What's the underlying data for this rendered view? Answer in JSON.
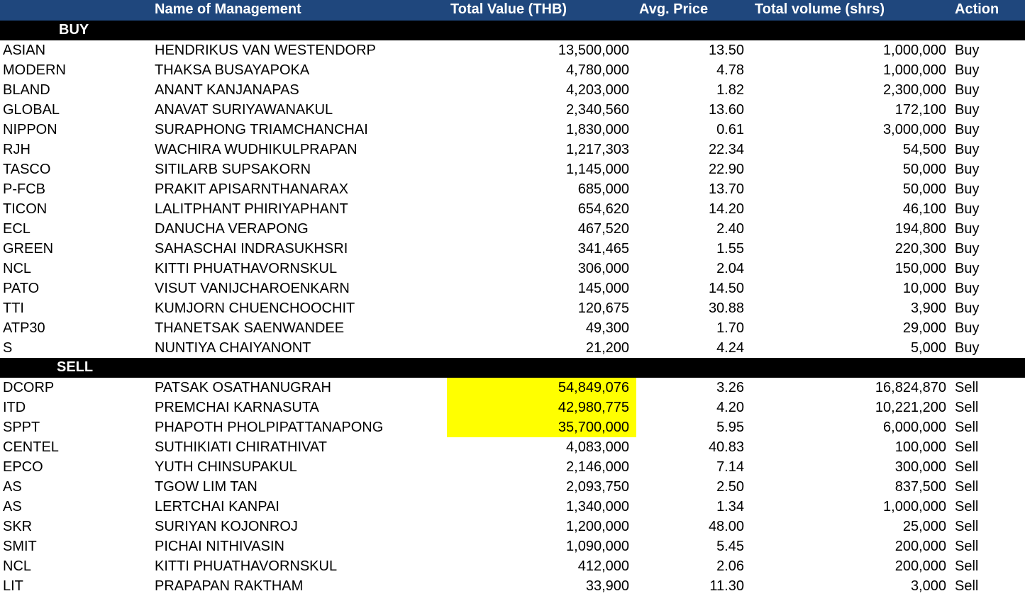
{
  "header": {
    "name": "Name of Management",
    "value": "Total Value (THB)",
    "price": "Avg. Price",
    "volume": "Total volume (shrs)",
    "action": "Action"
  },
  "colors": {
    "header_bg": "#1f477d",
    "band_bg": "#000000",
    "highlight": "#ffff00"
  },
  "buy": {
    "label": "BUY",
    "rows": [
      {
        "sym": "ASIAN",
        "name": "HENDRIKUS VAN  WESTENDORP",
        "value": "13,500,000",
        "price": "13.50",
        "volume": "1,000,000",
        "action": "Buy"
      },
      {
        "sym": "MODERN",
        "name": "THAKSA  BUSAYAPOKA",
        "value": "4,780,000",
        "price": "4.78",
        "volume": "1,000,000",
        "action": "Buy"
      },
      {
        "sym": "BLAND",
        "name": "ANANT  KANJANAPAS",
        "value": "4,203,000",
        "price": "1.82",
        "volume": "2,300,000",
        "action": "Buy"
      },
      {
        "sym": "GLOBAL",
        "name": "ANAVAT  SURIYAWANAKUL",
        "value": "2,340,560",
        "price": "13.60",
        "volume": "172,100",
        "action": "Buy"
      },
      {
        "sym": "NIPPON",
        "name": "SURAPHONG  TRIAMCHANCHAI",
        "value": "1,830,000",
        "price": "0.61",
        "volume": "3,000,000",
        "action": "Buy"
      },
      {
        "sym": "RJH",
        "name": "WACHIRA  WUDHIKULPRAPAN",
        "value": "1,217,303",
        "price": "22.34",
        "volume": "54,500",
        "action": "Buy"
      },
      {
        "sym": "TASCO",
        "name": "SITILARB  SUPSAKORN",
        "value": "1,145,000",
        "price": "22.90",
        "volume": "50,000",
        "action": "Buy"
      },
      {
        "sym": "P-FCB",
        "name": "PRAKIT  APISARNTHANARAX",
        "value": "685,000",
        "price": "13.70",
        "volume": "50,000",
        "action": "Buy"
      },
      {
        "sym": "TICON",
        "name": "LALITPHANT  PHIRIYAPHANT",
        "value": "654,620",
        "price": "14.20",
        "volume": "46,100",
        "action": "Buy"
      },
      {
        "sym": "ECL",
        "name": "DANUCHA  VERAPONG",
        "value": "467,520",
        "price": "2.40",
        "volume": "194,800",
        "action": "Buy"
      },
      {
        "sym": "GREEN",
        "name": "SAHASCHAI  INDRASUKHSRI",
        "value": "341,465",
        "price": "1.55",
        "volume": "220,300",
        "action": "Buy"
      },
      {
        "sym": "NCL",
        "name": "KITTI  PHUATHAVORNSKUL",
        "value": "306,000",
        "price": "2.04",
        "volume": "150,000",
        "action": "Buy"
      },
      {
        "sym": "PATO",
        "name": "VISUT  VANIJCHAROENKARN",
        "value": "145,000",
        "price": "14.50",
        "volume": "10,000",
        "action": "Buy"
      },
      {
        "sym": "TTI",
        "name": "KUMJORN  CHUENCHOOCHIT",
        "value": "120,675",
        "price": "30.88",
        "volume": "3,900",
        "action": "Buy"
      },
      {
        "sym": "ATP30",
        "name": "THANETSAK  SAENWANDEE",
        "value": "49,300",
        "price": "1.70",
        "volume": "29,000",
        "action": "Buy"
      },
      {
        "sym": "S",
        "name": "NUNTIYA  CHAIYANONT",
        "value": "21,200",
        "price": "4.24",
        "volume": "5,000",
        "action": "Buy"
      }
    ]
  },
  "sell": {
    "label": "SELL",
    "rows": [
      {
        "sym": "DCORP",
        "name": "PATSAK  OSATHANUGRAH",
        "value": "54,849,076",
        "price": "3.26",
        "volume": "16,824,870",
        "action": "Sell",
        "highlight": true
      },
      {
        "sym": "ITD",
        "name": "PREMCHAI  KARNASUTA",
        "value": "42,980,775",
        "price": "4.20",
        "volume": "10,221,200",
        "action": "Sell",
        "highlight": true
      },
      {
        "sym": "SPPT",
        "name": "PHAPOTH  PHOLPIPATTANAPONG",
        "value": "35,700,000",
        "price": "5.95",
        "volume": "6,000,000",
        "action": "Sell",
        "highlight": true
      },
      {
        "sym": "CENTEL",
        "name": "SUTHIKIATI  CHIRATHIVAT",
        "value": "4,083,000",
        "price": "40.83",
        "volume": "100,000",
        "action": "Sell"
      },
      {
        "sym": "EPCO",
        "name": "YUTH  CHINSUPAKUL",
        "value": "2,146,000",
        "price": "7.14",
        "volume": "300,000",
        "action": "Sell"
      },
      {
        "sym": "AS",
        "name": "TGOW LIM  TAN",
        "value": "2,093,750",
        "price": "2.50",
        "volume": "837,500",
        "action": "Sell"
      },
      {
        "sym": "AS",
        "name": "LERTCHAI  KANPAI",
        "value": "1,340,000",
        "price": "1.34",
        "volume": "1,000,000",
        "action": "Sell"
      },
      {
        "sym": "SKR",
        "name": "SURIYAN  KOJONROJ",
        "value": "1,200,000",
        "price": "48.00",
        "volume": "25,000",
        "action": "Sell"
      },
      {
        "sym": "SMIT",
        "name": "PICHAI  NITHIVASIN",
        "value": "1,090,000",
        "price": "5.45",
        "volume": "200,000",
        "action": "Sell"
      },
      {
        "sym": "NCL",
        "name": "KITTI  PHUATHAVORNSKUL",
        "value": "412,000",
        "price": "2.06",
        "volume": "200,000",
        "action": "Sell"
      },
      {
        "sym": "LIT",
        "name": "PRAPAPAN  RAKTHAM",
        "value": "33,900",
        "price": "11.30",
        "volume": "3,000",
        "action": "Sell"
      }
    ]
  }
}
